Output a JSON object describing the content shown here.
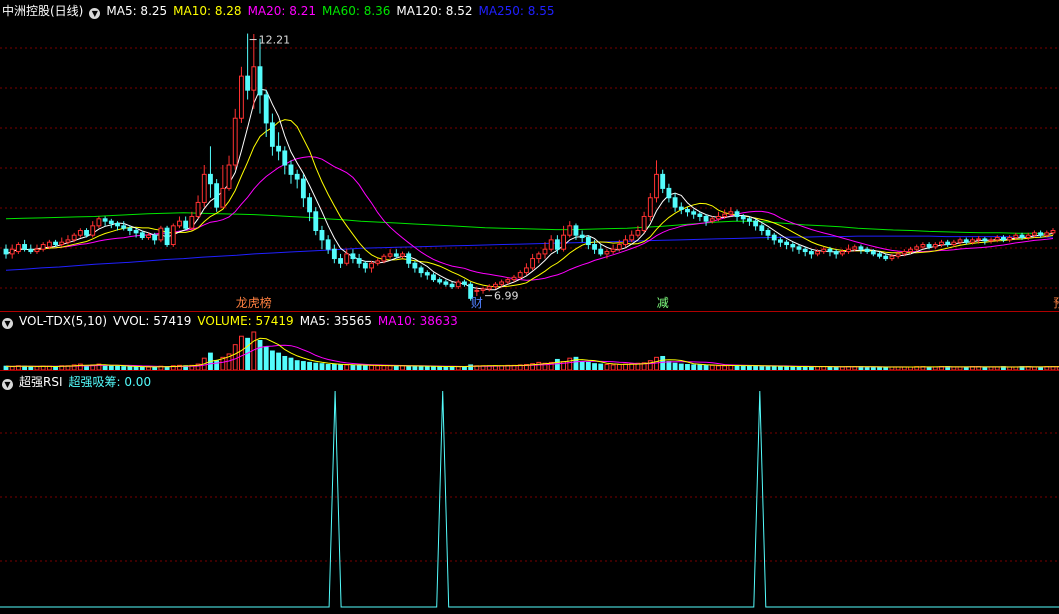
{
  "price_header": {
    "title": "中洲控股(日线)",
    "ma5": "MA5: 8.25",
    "ma10": "MA10: 8.28",
    "ma20": "MA20: 8.21",
    "ma60": "MA60: 8.36",
    "ma120": "MA120: 8.52",
    "ma250": "MA250: 8.55"
  },
  "vol_header": {
    "name": "VOL-TDX(5,10)",
    "vvol": "VVOL: 57419",
    "volume": "VOLUME: 57419",
    "ma5": "MA5: 35565",
    "ma10": "MA10: 38633"
  },
  "rsi_header": {
    "name": "超强RSI",
    "value": "超强吸筹: 0.00"
  },
  "colors": {
    "up": "#ff3232",
    "down": "#54fcfc",
    "ma5": "#ffffff",
    "ma10": "#ffff00",
    "ma20": "#ff00ff",
    "ma60": "#00e600",
    "ma250": "#2020ff",
    "grid": "#7a0000"
  },
  "chart_data": [
    {
      "type": "candlestick",
      "price_range": [
        6.6,
        12.5
      ],
      "annotations": [
        {
          "label": "12.21",
          "kind": "high",
          "index": 39
        },
        {
          "label": "6.99",
          "kind": "low",
          "index": 77
        }
      ],
      "markers": [
        {
          "label": "龙虎榜",
          "index": 40,
          "color": "#ff8040"
        },
        {
          "label": "财",
          "index": 76,
          "color": "#5080ff"
        },
        {
          "label": "减",
          "index": 106,
          "color": "#80ff80"
        },
        {
          "label": "预",
          "index": 170,
          "color": "#ff8040"
        }
      ],
      "ohlc": [
        [
          7.6,
          7.5,
          7.7,
          7.4
        ],
        [
          7.5,
          7.6,
          7.7,
          7.4
        ],
        [
          7.55,
          7.7,
          7.75,
          7.5
        ],
        [
          7.7,
          7.6,
          7.8,
          7.55
        ],
        [
          7.6,
          7.55,
          7.7,
          7.5
        ],
        [
          7.55,
          7.6,
          7.7,
          7.5
        ],
        [
          7.6,
          7.7,
          7.75,
          7.55
        ],
        [
          7.65,
          7.75,
          7.8,
          7.6
        ],
        [
          7.75,
          7.7,
          7.8,
          7.65
        ],
        [
          7.7,
          7.75,
          7.85,
          7.65
        ],
        [
          7.75,
          7.8,
          7.9,
          7.7
        ],
        [
          7.8,
          7.9,
          7.95,
          7.75
        ],
        [
          7.9,
          8.0,
          8.05,
          7.85
        ],
        [
          8.0,
          7.9,
          8.05,
          7.85
        ],
        [
          7.9,
          8.1,
          8.2,
          7.85
        ],
        [
          8.1,
          8.25,
          8.3,
          8.05
        ],
        [
          8.25,
          8.2,
          8.3,
          8.1
        ],
        [
          8.2,
          8.15,
          8.25,
          8.05
        ],
        [
          8.15,
          8.1,
          8.2,
          8.0
        ],
        [
          8.1,
          8.05,
          8.2,
          8.0
        ],
        [
          8.05,
          8.0,
          8.1,
          7.9
        ],
        [
          8.0,
          7.95,
          8.05,
          7.85
        ],
        [
          7.95,
          7.85,
          8.0,
          7.8
        ],
        [
          7.85,
          7.9,
          7.95,
          7.8
        ],
        [
          7.9,
          7.8,
          7.95,
          7.7
        ],
        [
          7.8,
          8.05,
          8.1,
          7.75
        ],
        [
          8.05,
          7.7,
          8.1,
          7.65
        ],
        [
          7.7,
          8.1,
          8.15,
          7.65
        ],
        [
          8.1,
          8.2,
          8.3,
          8.05
        ],
        [
          8.2,
          8.05,
          8.3,
          8.0
        ],
        [
          8.05,
          8.3,
          8.4,
          8.0
        ],
        [
          8.3,
          8.6,
          8.75,
          8.25
        ],
        [
          8.6,
          9.2,
          9.4,
          8.5
        ],
        [
          9.2,
          9.0,
          9.8,
          8.7
        ],
        [
          9.0,
          8.5,
          9.1,
          8.4
        ],
        [
          8.5,
          8.9,
          9.4,
          8.6
        ],
        [
          8.9,
          9.4,
          9.6,
          8.85
        ],
        [
          9.4,
          10.4,
          10.6,
          9.3
        ],
        [
          10.4,
          11.3,
          11.5,
          10.3
        ],
        [
          11.3,
          11.0,
          12.21,
          10.8
        ],
        [
          11.0,
          11.5,
          12.2,
          10.6
        ],
        [
          11.5,
          10.9,
          12.1,
          10.5
        ],
        [
          10.9,
          10.3,
          11.0,
          10.0
        ],
        [
          10.3,
          9.8,
          10.5,
          9.6
        ],
        [
          9.8,
          9.7,
          10.1,
          9.5
        ],
        [
          9.7,
          9.4,
          9.8,
          9.2
        ],
        [
          9.4,
          9.2,
          9.5,
          9.0
        ],
        [
          9.2,
          9.1,
          9.3,
          8.9
        ],
        [
          9.1,
          8.7,
          9.2,
          8.5
        ],
        [
          8.7,
          8.4,
          8.8,
          8.2
        ],
        [
          8.4,
          8.0,
          8.5,
          7.9
        ],
        [
          8.0,
          7.8,
          8.1,
          7.6
        ],
        [
          7.8,
          7.6,
          7.9,
          7.5
        ],
        [
          7.6,
          7.4,
          7.7,
          7.3
        ],
        [
          7.4,
          7.3,
          7.5,
          7.2
        ],
        [
          7.3,
          7.5,
          7.6,
          7.25
        ],
        [
          7.5,
          7.4,
          7.6,
          7.3
        ],
        [
          7.4,
          7.3,
          7.5,
          7.2
        ],
        [
          7.3,
          7.2,
          7.35,
          7.1
        ],
        [
          7.2,
          7.3,
          7.35,
          7.1
        ],
        [
          7.3,
          7.35,
          7.4,
          7.25
        ],
        [
          7.35,
          7.45,
          7.5,
          7.3
        ],
        [
          7.45,
          7.5,
          7.6,
          7.4
        ],
        [
          7.5,
          7.45,
          7.6,
          7.4
        ],
        [
          7.45,
          7.5,
          7.55,
          7.4
        ],
        [
          7.5,
          7.3,
          7.55,
          7.2
        ],
        [
          7.3,
          7.2,
          7.35,
          7.1
        ],
        [
          7.2,
          7.1,
          7.25,
          7.0
        ],
        [
          7.1,
          7.05,
          7.15,
          6.95
        ],
        [
          7.05,
          6.95,
          7.1,
          6.9
        ],
        [
          6.95,
          6.9,
          7.0,
          6.85
        ],
        [
          6.9,
          6.85,
          6.95,
          6.8
        ],
        [
          6.85,
          6.8,
          6.9,
          6.75
        ],
        [
          6.8,
          6.9,
          6.95,
          6.75
        ],
        [
          6.9,
          6.85,
          6.95,
          6.8
        ],
        [
          6.85,
          6.55,
          6.9,
          6.5
        ],
        [
          6.7,
          6.72,
          6.8,
          6.6
        ],
        [
          6.72,
          6.75,
          6.8,
          6.65
        ],
        [
          6.75,
          6.8,
          6.85,
          6.7
        ],
        [
          6.8,
          6.85,
          6.9,
          6.75
        ],
        [
          6.85,
          6.9,
          6.95,
          6.8
        ],
        [
          6.9,
          6.95,
          7.0,
          6.85
        ],
        [
          6.95,
          7.0,
          7.05,
          6.9
        ],
        [
          7.0,
          7.1,
          7.15,
          6.95
        ],
        [
          7.1,
          7.2,
          7.3,
          7.05
        ],
        [
          7.2,
          7.4,
          7.5,
          7.15
        ],
        [
          7.4,
          7.5,
          7.55,
          7.3
        ],
        [
          7.5,
          7.6,
          7.75,
          7.4
        ],
        [
          7.6,
          7.8,
          7.9,
          7.55
        ],
        [
          7.8,
          7.6,
          7.9,
          7.5
        ],
        [
          7.6,
          7.9,
          8.1,
          7.55
        ],
        [
          7.9,
          8.1,
          8.2,
          7.85
        ],
        [
          8.1,
          7.9,
          8.15,
          7.8
        ],
        [
          7.9,
          7.85,
          8.0,
          7.75
        ],
        [
          7.85,
          7.7,
          7.9,
          7.6
        ],
        [
          7.7,
          7.6,
          7.8,
          7.5
        ],
        [
          7.6,
          7.5,
          7.7,
          7.45
        ],
        [
          7.5,
          7.55,
          7.6,
          7.4
        ],
        [
          7.55,
          7.6,
          7.7,
          7.5
        ],
        [
          7.6,
          7.7,
          7.8,
          7.55
        ],
        [
          7.7,
          7.8,
          7.9,
          7.65
        ],
        [
          7.8,
          7.9,
          8.0,
          7.75
        ],
        [
          7.9,
          8.0,
          8.1,
          7.85
        ],
        [
          8.0,
          8.3,
          8.4,
          7.95
        ],
        [
          8.3,
          8.7,
          8.8,
          8.2
        ],
        [
          8.7,
          9.2,
          9.5,
          8.6
        ],
        [
          9.2,
          8.9,
          9.3,
          8.8
        ],
        [
          8.9,
          8.7,
          9.0,
          8.6
        ],
        [
          8.7,
          8.5,
          8.8,
          8.4
        ],
        [
          8.5,
          8.45,
          8.6,
          8.35
        ],
        [
          8.45,
          8.4,
          8.5,
          8.3
        ],
        [
          8.4,
          8.35,
          8.45,
          8.25
        ],
        [
          8.35,
          8.3,
          8.4,
          8.2
        ],
        [
          8.3,
          8.2,
          8.35,
          8.1
        ],
        [
          8.2,
          8.25,
          8.3,
          8.15
        ],
        [
          8.25,
          8.3,
          8.4,
          8.2
        ],
        [
          8.3,
          8.35,
          8.45,
          8.25
        ],
        [
          8.35,
          8.4,
          8.5,
          8.3
        ],
        [
          8.4,
          8.3,
          8.45,
          8.2
        ],
        [
          8.3,
          8.25,
          8.35,
          8.15
        ],
        [
          8.25,
          8.2,
          8.3,
          8.1
        ],
        [
          8.2,
          8.1,
          8.25,
          8.0
        ],
        [
          8.1,
          8.0,
          8.15,
          7.9
        ],
        [
          8.0,
          7.9,
          8.05,
          7.8
        ],
        [
          7.9,
          7.8,
          7.95,
          7.7
        ],
        [
          7.8,
          7.75,
          7.85,
          7.65
        ],
        [
          7.75,
          7.7,
          7.8,
          7.6
        ],
        [
          7.7,
          7.65,
          7.75,
          7.55
        ],
        [
          7.65,
          7.6,
          7.7,
          7.5
        ],
        [
          7.6,
          7.55,
          7.65,
          7.45
        ],
        [
          7.55,
          7.5,
          7.6,
          7.4
        ],
        [
          7.5,
          7.55,
          7.6,
          7.45
        ],
        [
          7.55,
          7.6,
          7.65,
          7.5
        ],
        [
          7.6,
          7.55,
          7.65,
          7.45
        ],
        [
          7.55,
          7.5,
          7.6,
          7.4
        ],
        [
          7.5,
          7.55,
          7.6,
          7.45
        ],
        [
          7.55,
          7.6,
          7.7,
          7.5
        ],
        [
          7.6,
          7.65,
          7.7,
          7.55
        ],
        [
          7.65,
          7.6,
          7.7,
          7.5
        ],
        [
          7.6,
          7.55,
          7.65,
          7.5
        ],
        [
          7.55,
          7.5,
          7.6,
          7.45
        ],
        [
          7.5,
          7.45,
          7.55,
          7.4
        ],
        [
          7.45,
          7.4,
          7.5,
          7.35
        ],
        [
          7.4,
          7.45,
          7.5,
          7.35
        ],
        [
          7.45,
          7.5,
          7.55,
          7.4
        ],
        [
          7.5,
          7.55,
          7.6,
          7.45
        ],
        [
          7.55,
          7.6,
          7.65,
          7.5
        ],
        [
          7.6,
          7.65,
          7.7,
          7.55
        ],
        [
          7.65,
          7.7,
          7.75,
          7.6
        ],
        [
          7.7,
          7.65,
          7.75,
          7.6
        ],
        [
          7.65,
          7.7,
          7.75,
          7.6
        ],
        [
          7.7,
          7.75,
          7.8,
          7.65
        ],
        [
          7.75,
          7.7,
          7.8,
          7.65
        ],
        [
          7.7,
          7.75,
          7.8,
          7.65
        ],
        [
          7.75,
          7.8,
          7.85,
          7.7
        ],
        [
          7.8,
          7.75,
          7.85,
          7.7
        ],
        [
          7.75,
          7.8,
          7.85,
          7.7
        ],
        [
          7.8,
          7.82,
          7.88,
          7.72
        ],
        [
          7.82,
          7.78,
          7.86,
          7.7
        ],
        [
          7.78,
          7.8,
          7.85,
          7.72
        ],
        [
          7.8,
          7.85,
          7.9,
          7.75
        ],
        [
          7.85,
          7.8,
          7.9,
          7.75
        ],
        [
          7.8,
          7.85,
          7.9,
          7.75
        ],
        [
          7.85,
          7.9,
          7.95,
          7.8
        ],
        [
          7.9,
          7.85,
          7.95,
          7.8
        ],
        [
          7.85,
          7.9,
          7.95,
          7.8
        ],
        [
          7.9,
          7.95,
          8.0,
          7.85
        ],
        [
          7.95,
          7.9,
          8.0,
          7.85
        ],
        [
          7.9,
          7.95,
          8.0,
          7.85
        ],
        [
          7.95,
          8.0,
          8.05,
          7.9
        ]
      ],
      "ma60": [
        8.25,
        8.26,
        8.27,
        8.28,
        8.29,
        8.3,
        8.32,
        8.34,
        8.36,
        8.37,
        8.38,
        8.37,
        8.36,
        8.35,
        8.34,
        8.32,
        8.3,
        8.28,
        8.25,
        8.23,
        8.2,
        8.18,
        8.16,
        8.14,
        8.12,
        8.1,
        8.08,
        8.06,
        8.05,
        8.04,
        8.03,
        8.02,
        8.02,
        8.03,
        8.04,
        8.05,
        8.07,
        8.09,
        8.12,
        8.15,
        8.18,
        8.2,
        8.2,
        8.18,
        8.15,
        8.12,
        8.1,
        8.08,
        8.05,
        8.03,
        8.01,
        8.0,
        7.98,
        7.97,
        7.96,
        7.95,
        7.95,
        7.94,
        7.94,
        7.93
      ],
      "ma250": [
        7.15,
        7.17,
        7.2,
        7.22,
        7.25,
        7.28,
        7.3,
        7.32,
        7.35,
        7.38,
        7.4,
        7.43,
        7.45,
        7.47,
        7.5,
        7.52,
        7.54,
        7.56,
        7.58,
        7.6,
        7.62,
        7.63,
        7.64,
        7.65,
        7.66,
        7.67,
        7.68,
        7.69,
        7.7,
        7.71,
        7.72,
        7.73,
        7.74,
        7.75,
        7.76,
        7.77,
        7.78,
        7.79,
        7.8,
        7.81,
        7.82,
        7.83,
        7.84,
        7.85,
        7.86,
        7.86,
        7.87,
        7.87,
        7.88,
        7.88,
        7.88,
        7.88,
        7.88,
        7.87,
        7.87,
        7.87,
        7.87,
        7.86,
        7.86,
        7.86
      ]
    },
    {
      "type": "bar",
      "volume": [
        9,
        8,
        10,
        9,
        8,
        8,
        9,
        9,
        8,
        10,
        10,
        12,
        14,
        10,
        12,
        14,
        11,
        10,
        9,
        8,
        8,
        8,
        7,
        7,
        7,
        9,
        8,
        10,
        11,
        10,
        11,
        14,
        28,
        40,
        22,
        30,
        38,
        60,
        80,
        75,
        90,
        70,
        55,
        45,
        40,
        32,
        28,
        22,
        20,
        18,
        16,
        15,
        13,
        13,
        12,
        12,
        12,
        11,
        11,
        11,
        10,
        10,
        10,
        10,
        10,
        9,
        9,
        9,
        9,
        8,
        8,
        8,
        8,
        8,
        8,
        12,
        10,
        10,
        10,
        10,
        10,
        11,
        11,
        12,
        13,
        15,
        18,
        16,
        18,
        25,
        20,
        28,
        30,
        20,
        18,
        15,
        14,
        13,
        12,
        13,
        14,
        15,
        16,
        17,
        22,
        30,
        32,
        20,
        16,
        14,
        13,
        12,
        12,
        11,
        11,
        10,
        10,
        11,
        11,
        10,
        10,
        10,
        9,
        9,
        9,
        9,
        8,
        8,
        8,
        8,
        8,
        8,
        8,
        8,
        7,
        7,
        8,
        8,
        8,
        7,
        7,
        7,
        7,
        7,
        7,
        7,
        7,
        8,
        8,
        7,
        7,
        8,
        8,
        7,
        7,
        7,
        8,
        8,
        7,
        7,
        7,
        8,
        7,
        7,
        8,
        8,
        7,
        7,
        8,
        8,
        8,
        9,
        9,
        9,
        10
      ]
    },
    {
      "type": "line",
      "values_at": [
        {
          "index": 55,
          "value": 100
        },
        {
          "index": 73,
          "value": 100
        },
        {
          "index": 126,
          "value": 100
        }
      ],
      "baseline": 0
    }
  ]
}
